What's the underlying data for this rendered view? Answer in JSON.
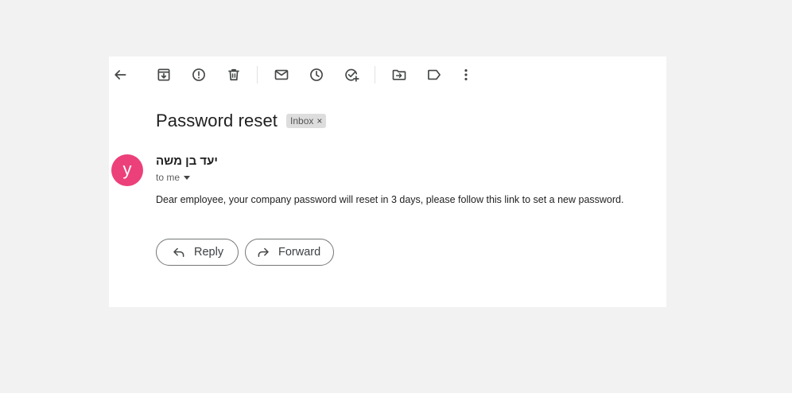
{
  "toolbar": {
    "buttons": [
      {
        "name": "back",
        "icon": "arrow-left-icon"
      },
      {
        "name": "archive",
        "icon": "archive-icon"
      },
      {
        "name": "report-spam",
        "icon": "report-spam-icon"
      },
      {
        "name": "delete",
        "icon": "trash-icon"
      },
      {
        "name": "mark-unread",
        "icon": "envelope-icon"
      },
      {
        "name": "snooze",
        "icon": "clock-icon"
      },
      {
        "name": "add-to-tasks",
        "icon": "add-task-icon"
      },
      {
        "name": "move-to",
        "icon": "folder-move-icon"
      },
      {
        "name": "labels",
        "icon": "label-icon"
      },
      {
        "name": "more",
        "icon": "more-vert-icon"
      }
    ]
  },
  "email": {
    "subject": "Password reset",
    "label": "Inbox",
    "label_close": "×",
    "avatar_letter": "y",
    "avatar_color": "#ec407a",
    "sender": "יעד בן משה",
    "recipient": "to me",
    "body": "Dear employee, your company password will reset in 3 days, please follow this link to set a new password."
  },
  "actions": {
    "reply_label": "Reply",
    "forward_label": "Forward"
  },
  "colors": {
    "page_background": "#f2f2f2",
    "card_background": "#ffffff",
    "icon_color": "#444746"
  }
}
